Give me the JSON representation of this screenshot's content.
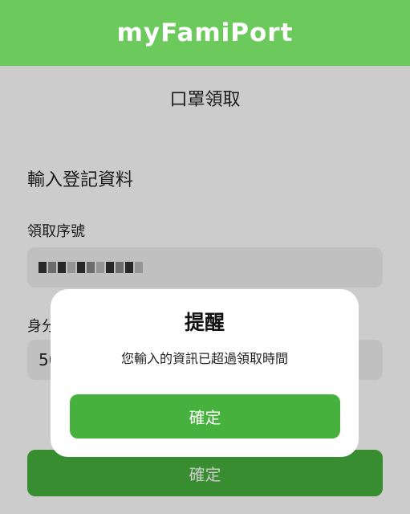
{
  "header": {
    "logo_text": "myFamiPort",
    "background_color": "#6cc95c"
  },
  "page": {
    "title": "口罩領取",
    "section_title": "輸入登記資料",
    "fields": [
      {
        "label": "領取序號",
        "value": "",
        "value_obscured": true
      },
      {
        "label": "身分",
        "value": "50",
        "value_obscured": false
      }
    ],
    "submit_label": "確定",
    "button_color": "#46b13c"
  },
  "dialog": {
    "title": "提醒",
    "message": "您輸入的資訊已超過領取時間",
    "confirm_label": "確定"
  }
}
